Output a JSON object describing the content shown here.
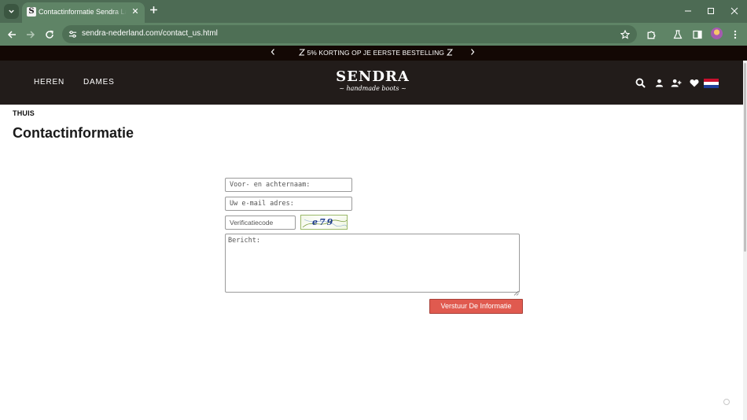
{
  "browser": {
    "tab_title": "Contactinformatie Sendra Laarzen",
    "favicon_letter": "S",
    "url": "sendra-nederland.com/contact_us.html",
    "theme_color": "#5f8466",
    "icons": {
      "tab_menu": "chevron-down-icon",
      "tab_close": "close-icon",
      "new_tab": "plus-icon",
      "minimize": "minimize-icon",
      "maximize": "maximize-icon",
      "close_window": "close-icon",
      "back": "arrow-left-icon",
      "forward": "arrow-right-icon",
      "reload": "reload-icon",
      "site_info": "tune-icon",
      "bookmark": "star-icon",
      "extensions": "puzzle-icon",
      "labs": "flask-icon",
      "side_panel": "side-panel-icon",
      "profile": "avatar-icon",
      "menu": "kebab-menu-icon"
    }
  },
  "promo": {
    "text": "5% KORTING OP JE EERSTE BESTELLING",
    "prev_icon": "chevron-left-icon",
    "next_icon": "chevron-right-icon",
    "background": "#130804"
  },
  "header": {
    "menu": [
      {
        "label": "HEREN"
      },
      {
        "label": "DAMES"
      }
    ],
    "logo_text": "SENDRA",
    "logo_tagline": "~ handmade boots ~",
    "icons": [
      "search-icon",
      "user-icon",
      "add-user-icon",
      "heart-icon",
      "netherlands-flag-icon"
    ],
    "background": "#221c1a"
  },
  "breadcrumb": "THUIS",
  "page_title": "Contactinformatie",
  "form": {
    "name_placeholder": "Voor- en achternaam:",
    "email_placeholder": "Uw e-mail adres:",
    "code_placeholder": "Verificatiecode",
    "captcha_text": "e79",
    "message_placeholder": "Bericht:",
    "submit_label": "Verstuur De Informatie",
    "submit_color": "#e05a4f"
  }
}
